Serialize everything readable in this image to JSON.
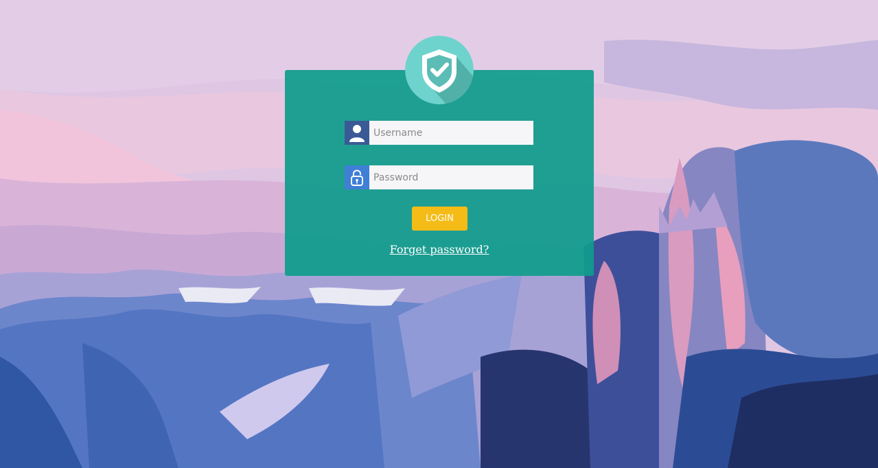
{
  "login": {
    "username_placeholder": "Username",
    "password_placeholder": "Password",
    "login_button": "LOGIN",
    "forgot_link": "Forget password?"
  },
  "icons": {
    "badge": "shield-check-icon",
    "username": "user-icon",
    "password": "padlock-icon"
  },
  "colors": {
    "panel": "#0f9c8c",
    "badge": "#6ed3cc",
    "login_button": "#f5bb17",
    "username_icon_bg": "#3a5a96",
    "password_icon_bg": "#3f7fd6"
  }
}
